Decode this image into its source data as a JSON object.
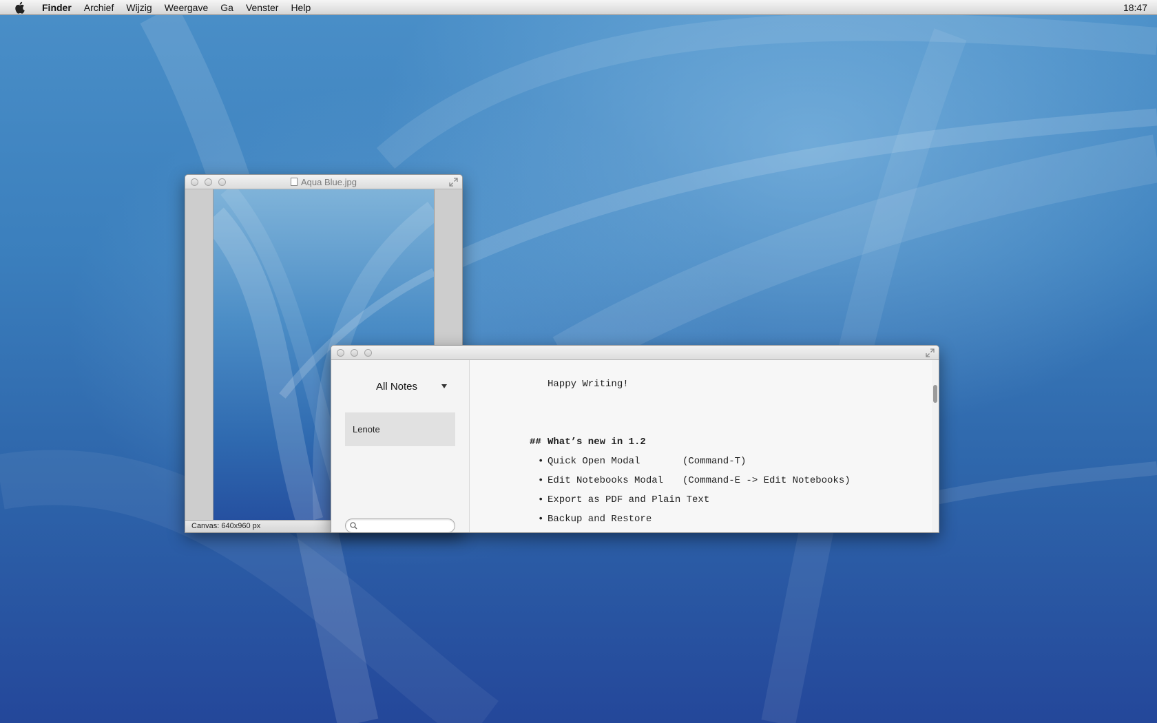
{
  "menubar": {
    "app_name": "Finder",
    "items": [
      "Archief",
      "Wijzig",
      "Weergave",
      "Ga",
      "Venster",
      "Help"
    ],
    "clock": "18:47"
  },
  "preview_window": {
    "title": "Aqua Blue.jpg",
    "status": "Canvas: 640x960 px"
  },
  "notes_window": {
    "notebook_selector": "All Notes",
    "notes": [
      "Lenote"
    ],
    "search": {
      "value": "",
      "placeholder": ""
    },
    "editor": {
      "intro": "Happy Writing!",
      "heading_marker": "##",
      "heading_text": "What’s new in 1.2",
      "bullet_glyph": "•",
      "features": [
        {
          "text": "Quick Open Modal",
          "shortcut": "(Command-T)"
        },
        {
          "text": "Edit Notebooks Modal",
          "shortcut": "(Command-E -> Edit Notebooks)"
        },
        {
          "text": "Export as PDF and Plain Text",
          "shortcut": ""
        },
        {
          "text": "Backup and Restore",
          "shortcut": ""
        }
      ]
    }
  }
}
